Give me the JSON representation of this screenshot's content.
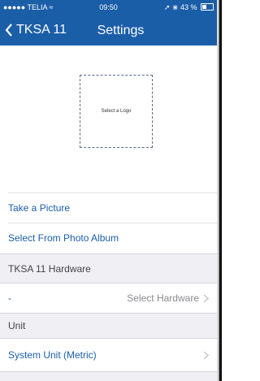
{
  "status": {
    "carrier": "●●●●● TELIA",
    "time": "09:50",
    "battery": "43 %"
  },
  "nav": {
    "back_label": "TKSA 11",
    "title": "Settings"
  },
  "logo": {
    "placeholder": "Select a Logo"
  },
  "actions": {
    "take_picture": "Take a Picture",
    "photo_album": "Select From Photo Album"
  },
  "hardware": {
    "header": "TKSA 11 Hardware",
    "value_left": "-",
    "value_right": "Select Hardware"
  },
  "unit": {
    "header": "Unit",
    "value": "System Unit (Metric)"
  },
  "colors": {
    "accent": "#1b5ea8",
    "section_bg": "#efeff4"
  }
}
